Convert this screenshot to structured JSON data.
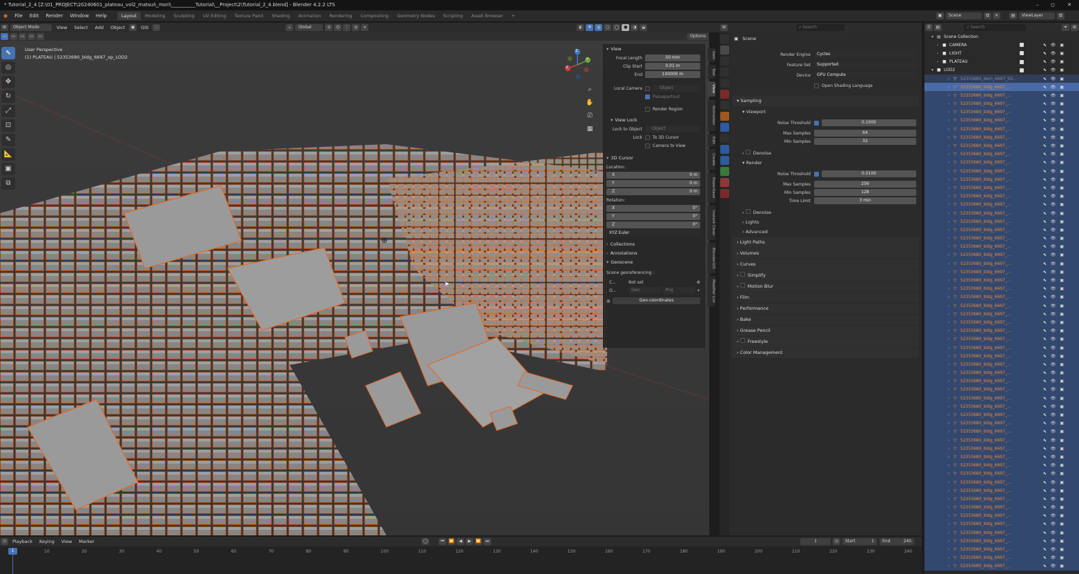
{
  "titlebar": {
    "title": "* Tutorial_2_4 [Z:\\01_PROJECT\\20240601_plateau_vol2_matsui\\_mori\\__________Tutorial\\__Project\\2\\Tutorial_2_4.blend] - Blender 4.2.2 LTS",
    "minimize": "–",
    "maximize": "◻",
    "close": "✕"
  },
  "menubar": {
    "logo": "◉",
    "menus": [
      "File",
      "Edit",
      "Render",
      "Window",
      "Help"
    ],
    "workspaces": [
      "Layout",
      "Modeling",
      "Sculpting",
      "UV Editing",
      "Texture Paint",
      "Shading",
      "Animation",
      "Rendering",
      "Compositing",
      "Geometry Nodes",
      "Scripting",
      "Asset Browser"
    ],
    "add_workspace": "+",
    "scene_label": "Scene",
    "viewlayer_label": "ViewLayer"
  },
  "viewport": {
    "mode": "Object Mode",
    "menus": [
      "View",
      "Select",
      "Add",
      "Object"
    ],
    "gis": "GIS",
    "transform": "Global",
    "options": "Options",
    "overlay_title": "User Perspective",
    "overlay_object": "(1) PLATEAU | 52353680_bldg_6697_op_LOD2",
    "gizmo_x": "X",
    "gizmo_y": "Y",
    "gizmo_z": "Z"
  },
  "npanel": {
    "view_header": "View",
    "focal_length_label": "Focal Length",
    "focal_length": "50 mm",
    "clip_start_label": "Clip Start",
    "clip_start": "0.01 m",
    "end_label": "End",
    "end": "100000 m",
    "local_camera_label": "Local Camera",
    "local_camera_placeholder": "Object",
    "passepartout": "Passepartout",
    "render_region": "Render Region",
    "view_lock_header": "View Lock",
    "lock_to_object_label": "Lock to Object",
    "lock_to_object_placeholder": "Object",
    "lock_label": "Lock",
    "to_3d_cursor": "To 3D Cursor",
    "camera_to_view": "Camera to View",
    "cursor_header": "3D Cursor",
    "location_label": "Location:",
    "loc_x": "0 m",
    "loc_y": "0 m",
    "loc_z": "0 m",
    "rotation_label": "Rotation:",
    "rot_x": "0°",
    "rot_y": "0°",
    "rot_z": "0°",
    "axis_x": "X",
    "axis_y": "Y",
    "axis_z": "Z",
    "rotation_mode": "XYZ Euler",
    "collections": "Collections",
    "annotations": "Annotations",
    "geoscene": "Geoscene",
    "scene_georef": "Scene georeferencing :",
    "crs_short": "C...",
    "crs_value": "Not set",
    "origin_short": "O...",
    "origin_geo": "Geo",
    "origin_proj": "Proj",
    "geo_coordinates": "Geo-coordinates",
    "tabs": [
      "Item",
      "Tool",
      "View",
      "Animation",
      "Edit",
      "Create",
      "PowerSave",
      "Instant Clean",
      "BlenderGIS",
      "Modifier List"
    ]
  },
  "properties": {
    "search_placeholder": "Search",
    "scene_title": "Scene",
    "render_engine_label": "Render Engine",
    "render_engine": "Cycles",
    "feature_set_label": "Feature Set",
    "feature_set": "Supported",
    "device_label": "Device",
    "device": "GPU Compute",
    "osl": "Open Shading Language",
    "sampling": "Sampling",
    "viewport": "Viewport",
    "noise_threshold_label": "Noise Threshold",
    "vp_noise": "0.1000",
    "max_samples_label": "Max Samples",
    "vp_max": "64",
    "min_samples_label": "Min Samples",
    "vp_min": "32",
    "denoise": "Denoise",
    "render": "Render",
    "r_noise": "0.0100",
    "r_max": "256",
    "r_min": "128",
    "time_limit_label": "Time Limit",
    "time_limit": "3 min",
    "lights": "Lights",
    "advanced": "Advanced",
    "sections": [
      "Light Paths",
      "Volumes",
      "Curves",
      "Simplify",
      "Motion Blur",
      "Film",
      "Performance",
      "Bake",
      "Grease Pencil",
      "Freestyle",
      "Color Management"
    ]
  },
  "outliner": {
    "search_placeholder": "Search",
    "collection_root": "Scene Collection",
    "collections": [
      "CAMERA",
      "LIGHT",
      "PLATEAU",
      "LOD2"
    ],
    "first_object": "52353680_dem_6697_50...",
    "object_name": "52353680_bldg_6697_..."
  },
  "timeline": {
    "menus": [
      "Playback",
      "Keying",
      "View",
      "Marker"
    ],
    "current_frame": "1",
    "start_label": "Start",
    "start": "1",
    "end_label": "End",
    "end": "240",
    "ticks": [
      "10",
      "20",
      "30",
      "40",
      "50",
      "60",
      "70",
      "80",
      "90",
      "100",
      "110",
      "120",
      "130",
      "140",
      "150",
      "160",
      "170",
      "180",
      "190",
      "200",
      "210",
      "220",
      "230",
      "240"
    ],
    "frame_marker": "1"
  },
  "colors": {
    "selection_orange": "#f08a3c",
    "active_blue": "#4772b3",
    "outliner_selected": "#33486e"
  }
}
